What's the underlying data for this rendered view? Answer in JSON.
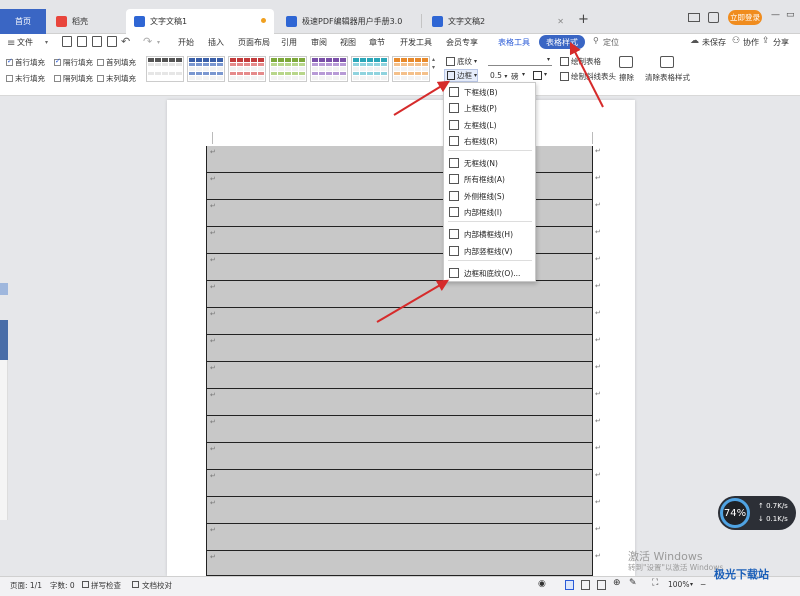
{
  "tabs": {
    "home": "首页",
    "daoke": "稻壳",
    "doc1": "文字文稿1",
    "pdf": "极速PDF编辑器用户手册3.0",
    "doc2": "文字文稿2",
    "new_tab": "+"
  },
  "titlebar": {
    "login": "立即登录"
  },
  "menu": {
    "file": "文件",
    "start": "开始",
    "insert": "插入",
    "layout": "页面布局",
    "reference": "引用",
    "review": "审阅",
    "view": "视图",
    "chapter": "章节",
    "devtools": "开发工具",
    "vip": "会员专享",
    "table_tools": "表格工具",
    "table_style": "表格样式",
    "locate": "定位",
    "unsaved": "未保存",
    "collab": "协作",
    "share": "分享"
  },
  "ribbon": {
    "first_row_fill": "首行填充",
    "alt_row_fill": "隔行填充",
    "first_col_fill": "首列填充",
    "last_row_fill": "末行填充",
    "alt_col_fill": "隔列填充",
    "last_col_fill": "末列填充",
    "shading": "底纹",
    "border": "边框",
    "line_width": "0.5",
    "line_unit": "磅",
    "draw_table": "绘制表格",
    "draw_slash_header": "绘制斜线表头",
    "erase": "擦除",
    "clear_style": "清除表格样式"
  },
  "border_menu": {
    "items": [
      "下框线(B)",
      "上框线(P)",
      "左框线(L)",
      "右框线(R)",
      "无框线(N)",
      "所有框线(A)",
      "外侧框线(S)",
      "内部框线(I)",
      "内部横框线(H)",
      "内部竖框线(V)",
      "边框和底纹(O)..."
    ]
  },
  "status": {
    "page": "页面: 1/1",
    "words": "字数: 0",
    "spell": "拼写检查",
    "proof": "文档校对",
    "zoom": "100%"
  },
  "speed_widget": {
    "percent": "74%",
    "up": "0.7K/s",
    "down": "0.1K/s"
  },
  "watermark": {
    "line1": "激活 Windows",
    "line2": "转到\"设置\"以激活 Windows",
    "brand": "极光下载站"
  },
  "colors": {
    "accent": "#3a66c4",
    "arrow": "#d62b2b",
    "table_fill": "#c8c8c8"
  }
}
